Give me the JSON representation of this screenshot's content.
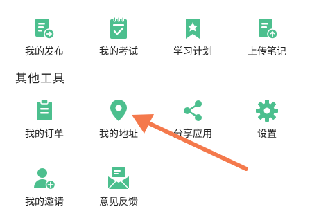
{
  "accent_color": "#4cbf8e",
  "annotation_color": "#f4794c",
  "top_row": [
    {
      "label": "我的发布",
      "icon": "document-share-icon"
    },
    {
      "label": "我的考试",
      "icon": "exam-clipboard-icon"
    },
    {
      "label": "学习计划",
      "icon": "star-bookmark-icon"
    },
    {
      "label": "上传笔记",
      "icon": "note-upload-icon"
    }
  ],
  "section": {
    "title": "其他工具"
  },
  "tools": [
    {
      "label": "我的订单",
      "icon": "order-clipboard-icon"
    },
    {
      "label": "我的地址",
      "icon": "location-pin-icon"
    },
    {
      "label": "分享应用",
      "icon": "share-icon"
    },
    {
      "label": "设置",
      "icon": "gear-icon"
    },
    {
      "label": "我的邀请",
      "icon": "invite-user-icon"
    },
    {
      "label": "意见反馈",
      "icon": "feedback-envelope-icon"
    }
  ]
}
